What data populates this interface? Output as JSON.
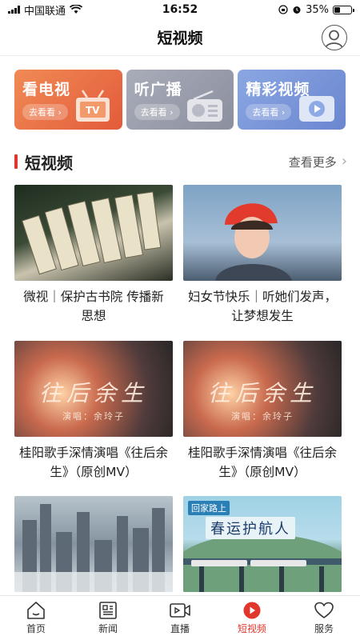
{
  "status_bar": {
    "carrier": "中国联通",
    "time": "16:52",
    "battery": "35%",
    "battery_level": 0.35
  },
  "header": {
    "title": "短视频"
  },
  "categories": [
    {
      "title": "看电视",
      "sub": "去看看 ›",
      "icon": "tv-icon",
      "color": "#e9683f"
    },
    {
      "title": "听广播",
      "sub": "去看看 ›",
      "icon": "radio-icon",
      "color": "#9a9eac"
    },
    {
      "title": "精彩视频",
      "sub": "去看看 ›",
      "icon": "video-play-icon",
      "color": "#7896d9"
    }
  ],
  "section": {
    "title": "短视频",
    "more": "查看更多",
    "accent": "#e0362b"
  },
  "videos": [
    {
      "title": "微视｜保护古书院 传播新思想"
    },
    {
      "title": "妇女节快乐｜听她们发声，让梦想发生"
    },
    {
      "title": "桂阳歌手深情演唱《往后余生》（原创MV）",
      "overlay": "往后余生",
      "overlay_sub": "演唱：余玲子"
    },
    {
      "title": "桂阳歌手深情演唱《往后余生》（原创MV）",
      "overlay": "往后余生",
      "overlay_sub": "演唱：余玲子"
    },
    {
      "title": ""
    },
    {
      "title": "",
      "overlay_label": "回家路上",
      "overlay": "春运护航人"
    }
  ],
  "tabbar": {
    "items": [
      {
        "label": "首页",
        "icon": "home-icon"
      },
      {
        "label": "新闻",
        "icon": "news-icon"
      },
      {
        "label": "直播",
        "icon": "live-icon"
      },
      {
        "label": "短视频",
        "icon": "short-video-icon",
        "active": true
      },
      {
        "label": "服务",
        "icon": "heart-icon"
      }
    ],
    "active_color": "#e0362b"
  }
}
